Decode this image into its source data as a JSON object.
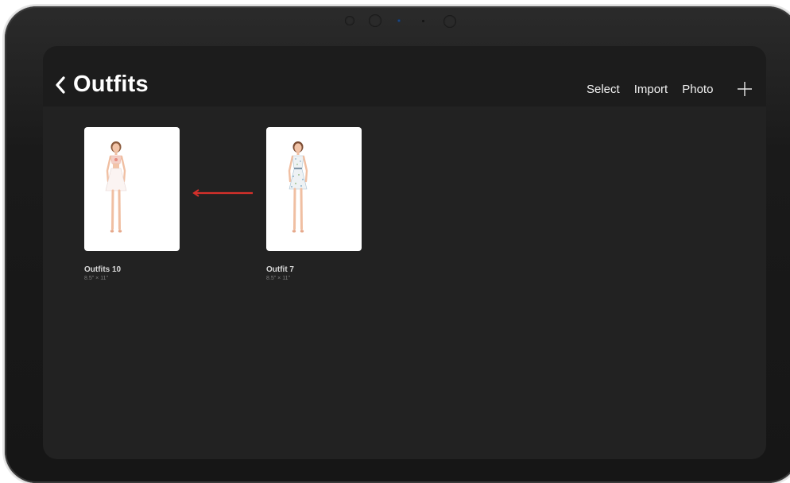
{
  "header": {
    "back_icon": "chevron-left-icon",
    "title": "Outfits",
    "actions": {
      "select": "Select",
      "import": "Import",
      "photo": "Photo"
    },
    "add_icon": "plus-icon"
  },
  "gallery": {
    "items": [
      {
        "name": "Outfits 10",
        "size": "8.5\" × 11\"",
        "dress_color": "#f7d9d4",
        "accent_color": "#e88a7e"
      },
      {
        "name": "Outfit 7",
        "size": "8.5\" × 11\"",
        "dress_color": "#eef2f4",
        "accent_color": "#8fb3c9"
      }
    ]
  },
  "annotation": {
    "arrow_color": "#d6302b",
    "arrow_direction": "left"
  },
  "colors": {
    "screen_background": "#222222",
    "navbar_background": "#1c1c1c",
    "text_primary": "#ffffff"
  }
}
